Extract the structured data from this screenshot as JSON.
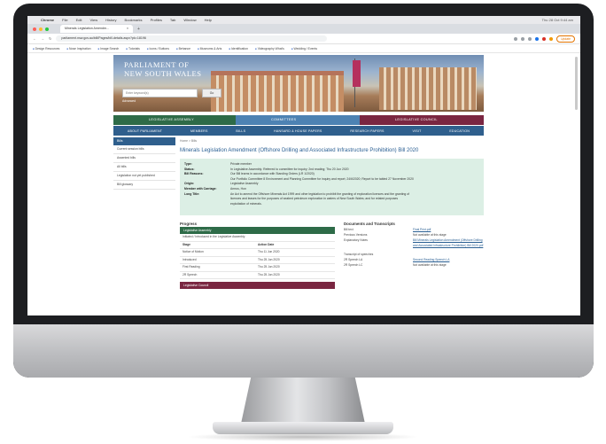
{
  "menubar": {
    "app": "Chrome",
    "items": [
      "File",
      "Edit",
      "View",
      "History",
      "Bookmarks",
      "Profiles",
      "Tab",
      "Window",
      "Help"
    ],
    "clock": "Thu 28 Oct 9:44 am"
  },
  "tab": {
    "title": "Minerals Legislation Amendm...",
    "close": "×",
    "new": "+"
  },
  "url": {
    "value": "parliament.nsw.gov.au/bill/Pages/bill-details.aspx?pk=18196",
    "update": "Update"
  },
  "bookmarks": [
    "Design Resources",
    "Nose Inspiration",
    "Image Search",
    "Tutorials",
    "Icons / Buttons",
    "Behance",
    "Museums & Arts",
    "Identification",
    "Videography What's",
    "Wedding / Events"
  ],
  "site": {
    "brand_line1": "Parliament of",
    "brand_line2": "New South Wales",
    "search_placeholder": "Enter keyword(s)",
    "search_button": "Go",
    "search_sub": "Advanced",
    "houses": [
      "Legislative Assembly",
      "Committees",
      "Legislative Council"
    ],
    "nav": [
      "About Parliament",
      "Members",
      "Bills",
      "Hansard & House Papers",
      "Research Papers",
      "Visit",
      "Education"
    ]
  },
  "sidebar": {
    "head": "Bills",
    "items": [
      "Current session bills",
      "Assented bills",
      "All bills",
      "Legislation not yet published",
      "Bill glossary"
    ]
  },
  "main": {
    "crumb": "Home > Bills",
    "title": "Minerals Legislation Amendment (Offshore Drilling and Associated Infrastructure Prohibition) Bill 2020",
    "details": [
      {
        "k": "Type:",
        "v": "Private member"
      },
      {
        "k": "Status:",
        "v": "In Legislative Assembly: Referred to committee for inquiry; 2nd reading; Thu 20 Jun 2020"
      },
      {
        "k": "Bill Reasons:",
        "v": "Our Bill learns in accordance with Standing Orders (LR 1/2020)"
      },
      {
        "k": "",
        "v": "Our Portfolio Committee 8 Environment and Planning Committee for inquiry and report; 24/6/2020; Report to be tabled 27 November 2020"
      },
      {
        "k": "Origin:",
        "v": "Legislative Assembly"
      },
      {
        "k": "Member with Carriage:",
        "v": "Amrus, Hon"
      },
      {
        "k": "Long Title:",
        "v": "An Act to amend the Offshore Minerals Act 1999 and other legislation to prohibit the granting of exploration licences and the granting of"
      },
      {
        "k": "",
        "v": "licences and leases for the purposes of seabed petroleum exploration in waters of New South Wales; and for related purposes"
      },
      {
        "k": "",
        "v": "exploitation of minerals."
      }
    ],
    "progress": {
      "title": "Progress",
      "la_band": "Legislative Assembly",
      "la_note": "Initiated / Introduced in the Legislative Assembly",
      "head": [
        "Stage",
        "Action Date"
      ],
      "rows": [
        [
          "Notice of Motion",
          "Thu 11 Jun 2020"
        ],
        [
          "Introduced",
          "Thu 25 Jun 2020"
        ],
        [
          "First Reading",
          "Thu 25 Jun 2020"
        ],
        [
          "2R Speech",
          "Thu 25 Jun 2020"
        ]
      ],
      "lc_band": "Legislative Council"
    },
    "docs": {
      "title": "Documents and Transcripts",
      "rows": [
        {
          "a": "Bill text",
          "b": "Final Print.pdf"
        },
        {
          "a": "Previous Versions",
          "b": "Not available at this stage"
        },
        {
          "a": "Explanatory Notes",
          "b": "Bill Minerals Legislation Amendment (Offshore Drilling and Associated Infrastructure Prohibition) Bill 2020.pdf"
        },
        {
          "a": "Transcript of speeches",
          "b": ""
        },
        {
          "a": "2R Speech LA",
          "b": "Second Reading Speech LA"
        },
        {
          "a": "2R Speech LC",
          "b": "Not available at this stage"
        }
      ]
    }
  }
}
